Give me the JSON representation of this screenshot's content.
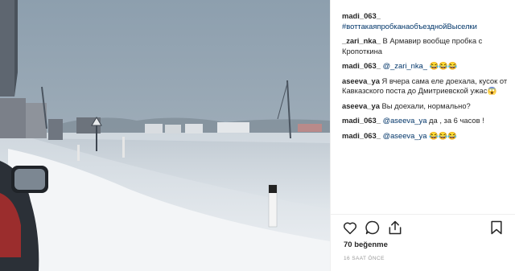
{
  "post": {
    "image_icon": "snowy-highway-traffic-jam-photo"
  },
  "comments": [
    {
      "user": "madi_063_",
      "text": " ",
      "tag": "#воттакаяпробканаобъезднойВыселки"
    },
    {
      "user": "_zari_nka_",
      "text": " В Армавир вообще пробка с Кропоткина"
    },
    {
      "user": "madi_063_",
      "mention": "@_zari_nka_",
      "text": " 😂😂😂"
    },
    {
      "user": "aseeva_ya",
      "text": " Я вчера сама еле доехала, кусок от Кавказского поста до Дмитриевской ужас😱"
    },
    {
      "user": "aseeva_ya",
      "text": " Вы доехали, нормально?"
    },
    {
      "user": "madi_063_",
      "mention": "@aseeva_ya",
      "text": " да , за 6 часов !"
    },
    {
      "user": "madi_063_",
      "mention": "@aseeva_ya",
      "text": " 😂😂😂"
    }
  ],
  "actions": {
    "like_icon": "heart-icon",
    "comment_icon": "comment-icon",
    "share_icon": "share-icon",
    "save_icon": "bookmark-icon"
  },
  "likes_label": "70 beğenme",
  "timestamp": "16 SAAT ÖNCE",
  "colors": {
    "link": "#003569",
    "text": "#262626",
    "muted": "#999999"
  }
}
